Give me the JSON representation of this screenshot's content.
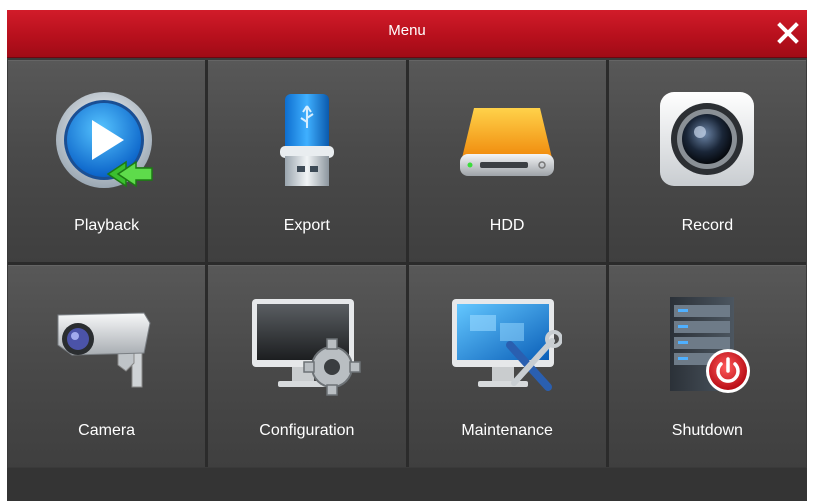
{
  "window": {
    "title": "Menu",
    "close_icon": "close-icon",
    "accent_color": "#c8141f"
  },
  "menu": {
    "items": [
      {
        "label": "Playback",
        "icon": "playback-icon"
      },
      {
        "label": "Export",
        "icon": "usb-drive-icon"
      },
      {
        "label": "HDD",
        "icon": "hard-drive-icon"
      },
      {
        "label": "Record",
        "icon": "camera-lens-icon"
      },
      {
        "label": "Camera",
        "icon": "security-camera-icon"
      },
      {
        "label": "Configuration",
        "icon": "monitor-gear-icon"
      },
      {
        "label": "Maintenance",
        "icon": "monitor-tools-icon"
      },
      {
        "label": "Shutdown",
        "icon": "server-power-icon"
      }
    ]
  }
}
